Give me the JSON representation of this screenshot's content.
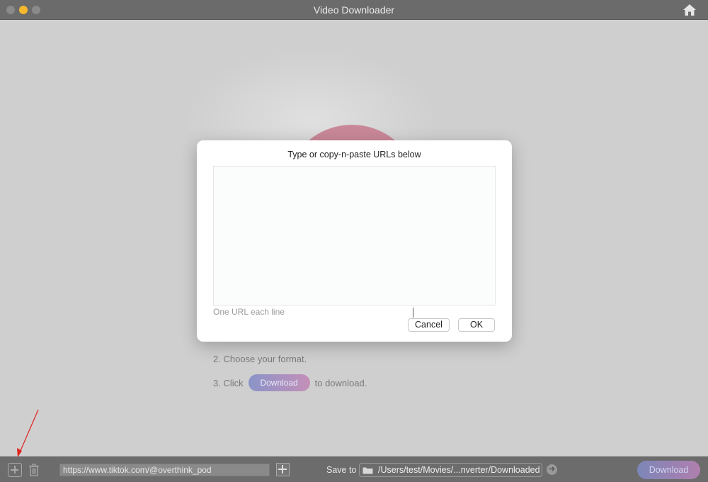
{
  "window": {
    "title": "Video Downloader",
    "icons": {
      "home": "home-icon"
    }
  },
  "main": {
    "steps": {
      "step2": "2. Choose your format.",
      "step3_prefix": "3. Click",
      "step3_button": "Download",
      "step3_suffix": "to download."
    }
  },
  "dialog": {
    "title": "Type or copy-n-paste URLs below",
    "textarea_value": "",
    "hint": "One URL each line",
    "cancel_label": "Cancel",
    "ok_label": "OK"
  },
  "bottom": {
    "url_value": "https://www.tiktok.com/@overthink_pod",
    "save_label": "Save to",
    "save_path": "/Users/test/Movies/...nverter/Downloaded",
    "download_label": "Download"
  },
  "colors": {
    "accent_start": "#8a94c8",
    "accent_end": "#c48fb8",
    "annotation_arrow": "#e0221c"
  }
}
